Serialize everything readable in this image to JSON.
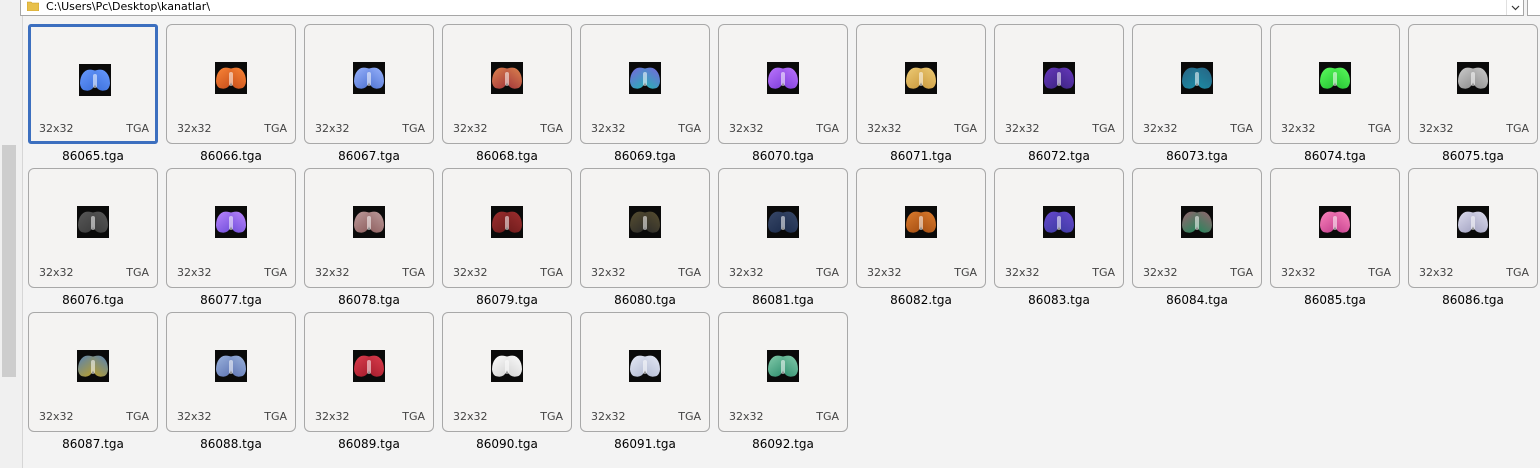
{
  "address_bar": {
    "path": "C:\\Users\\Pc\\Desktop\\kanatlar\\"
  },
  "items": [
    {
      "name": "86065.tga",
      "dim": "32x32",
      "ext": "TGA",
      "selected": true,
      "c1": "#3a6dd9",
      "c2": "#6a9cff"
    },
    {
      "name": "86066.tga",
      "dim": "32x32",
      "ext": "TGA",
      "c1": "#c24a18",
      "c2": "#ff8a3a"
    },
    {
      "name": "86067.tga",
      "dim": "32x32",
      "ext": "TGA",
      "c1": "#4a6fd0",
      "c2": "#9fb8ff"
    },
    {
      "name": "86068.tga",
      "dim": "32x32",
      "ext": "TGA",
      "c1": "#a0303a",
      "c2": "#e08a50"
    },
    {
      "name": "86069.tga",
      "dim": "32x32",
      "ext": "TGA",
      "c1": "#1fb8b0",
      "c2": "#8060e0"
    },
    {
      "name": "86070.tga",
      "dim": "32x32",
      "ext": "TGA",
      "c1": "#7a3ad8",
      "c2": "#c07aff"
    },
    {
      "name": "86071.tga",
      "dim": "32x32",
      "ext": "TGA",
      "c1": "#c8963a",
      "c2": "#f0cf7a"
    },
    {
      "name": "86072.tga",
      "dim": "32x32",
      "ext": "TGA",
      "c1": "#3a2380",
      "c2": "#6a3ac0"
    },
    {
      "name": "86073.tga",
      "dim": "32x32",
      "ext": "TGA",
      "c1": "#1a8fa8",
      "c2": "#2a6080"
    },
    {
      "name": "86074.tga",
      "dim": "32x32",
      "ext": "TGA",
      "c1": "#20c030",
      "c2": "#60ff60"
    },
    {
      "name": "86075.tga",
      "dim": "32x32",
      "ext": "TGA",
      "c1": "#8a8a8a",
      "c2": "#d0d0d0"
    },
    {
      "name": "86076.tga",
      "dim": "32x32",
      "ext": "TGA",
      "c1": "#3a3a3a",
      "c2": "#5a5a5a"
    },
    {
      "name": "86077.tga",
      "dim": "32x32",
      "ext": "TGA",
      "c1": "#6a4ad8",
      "c2": "#c08aff"
    },
    {
      "name": "86078.tga",
      "dim": "32x32",
      "ext": "TGA",
      "c1": "#8a5a5a",
      "c2": "#c0a0a0"
    },
    {
      "name": "86079.tga",
      "dim": "32x32",
      "ext": "TGA",
      "c1": "#6a1a1a",
      "c2": "#a03030"
    },
    {
      "name": "86080.tga",
      "dim": "32x32",
      "ext": "TGA",
      "c1": "#2a2a2a",
      "c2": "#5a5030"
    },
    {
      "name": "86081.tga",
      "dim": "32x32",
      "ext": "TGA",
      "c1": "#1a2a4a",
      "c2": "#3a4a6a"
    },
    {
      "name": "86082.tga",
      "dim": "32x32",
      "ext": "TGA",
      "c1": "#a04a10",
      "c2": "#e08030"
    },
    {
      "name": "86083.tga",
      "dim": "32x32",
      "ext": "TGA",
      "c1": "#3a3aa0",
      "c2": "#6a4ad0"
    },
    {
      "name": "86084.tga",
      "dim": "32x32",
      "ext": "TGA",
      "c1": "#1a8a5a",
      "c2": "#a06070"
    },
    {
      "name": "86085.tga",
      "dim": "32x32",
      "ext": "TGA",
      "c1": "#c03a8a",
      "c2": "#ff8ac0"
    },
    {
      "name": "86086.tga",
      "dim": "32x32",
      "ext": "TGA",
      "c1": "#a0a0c0",
      "c2": "#e0e0f0"
    },
    {
      "name": "86087.tga",
      "dim": "32x32",
      "ext": "TGA",
      "c1": "#c0a020",
      "c2": "#5080c0"
    },
    {
      "name": "86088.tga",
      "dim": "32x32",
      "ext": "TGA",
      "c1": "#5a70b0",
      "c2": "#a0b8e0"
    },
    {
      "name": "86089.tga",
      "dim": "32x32",
      "ext": "TGA",
      "c1": "#a01a2a",
      "c2": "#e04050"
    },
    {
      "name": "86090.tga",
      "dim": "32x32",
      "ext": "TGA",
      "c1": "#d0d0d0",
      "c2": "#ffffff"
    },
    {
      "name": "86091.tga",
      "dim": "32x32",
      "ext": "TGA",
      "c1": "#b0b8d0",
      "c2": "#e8ecf8"
    },
    {
      "name": "86092.tga",
      "dim": "32x32",
      "ext": "TGA",
      "c1": "#2a8a6a",
      "c2": "#8ad0b0"
    }
  ],
  "colors": {
    "selection": "#3c6fbf",
    "tile_border": "#a8a8a8"
  }
}
